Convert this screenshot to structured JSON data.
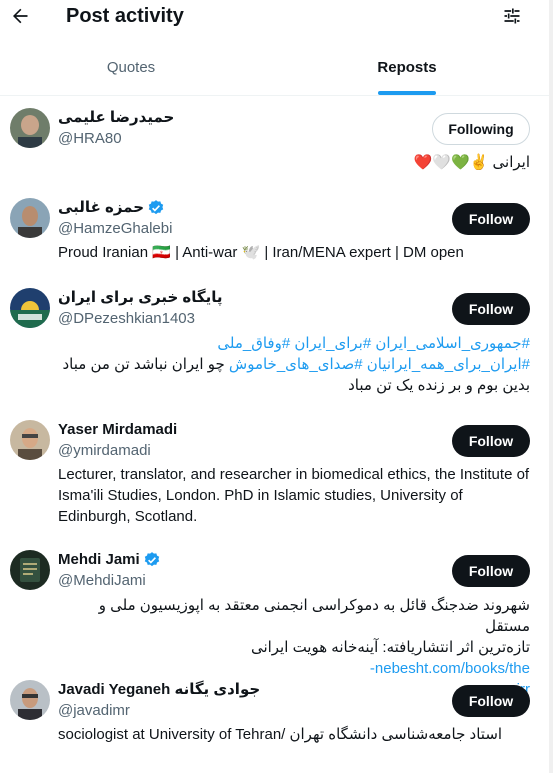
{
  "header": {
    "title": "Post activity"
  },
  "tabs": [
    {
      "label": "Quotes",
      "selected": false
    },
    {
      "label": "Reposts",
      "selected": true
    }
  ],
  "colors": {
    "accent": "#1d9bf0",
    "text_primary": "#0f1419",
    "text_secondary": "#536471",
    "follow_button_bg": "#0f1419"
  },
  "users": [
    {
      "name": "حمیدرضا علیمی",
      "handle": "@HRA80",
      "verified": false,
      "button": "Following",
      "bio": "ایرانی ✌️💚🤍❤️"
    },
    {
      "name": "حمزه غالبی",
      "handle": "@HamzeGhalebi",
      "verified": true,
      "button": "Follow",
      "bio": "Proud Iranian 🇮🇷 | Anti-war 🕊️ | Iran/MENA expert | DM open"
    },
    {
      "name": "پایگاه خبری برای ایران",
      "handle": "@DPezeshkian1403",
      "verified": false,
      "button": "Follow",
      "bio_tags_line1": "#جمهوری_اسلامی_ایران #برای_ایران #وفاق_ملی",
      "bio_tags_line2": "#ایران_برای_همه_ایرانیان #صدای_های_خاموش",
      "bio_text_line2": " چو ایران نباشد تن من مباد",
      "bio_text_line3": "بدین بوم و بر زنده یک تن مباد"
    },
    {
      "name": "Yaser Mirdamadi",
      "handle": "@ymirdamadi",
      "verified": false,
      "button": "Follow",
      "bio": "Lecturer, translator, and researcher in biomedical ethics, the Institute of Isma'ili Studies, London. PhD in Islamic studies, University of Edinburgh, Scotland."
    },
    {
      "name": "Mehdi Jami",
      "handle": "@MehdiJami",
      "verified": true,
      "button": "Follow",
      "bio_line1": "شهروند ضدجنگ قائل به دموکراسی انجمنی معتقد به اپوزیسیون ملی و مستقل",
      "bio_line2_text": "تازه‌ترین اثر انتشاریافته: آینه‌خانه هویت ایرانی",
      "bio_line2_link": "nebesht.com/books/the-",
      "bio_line3_link": "mirr..."
    },
    {
      "name": "Javadi Yeganeh جوادی یگانه",
      "handle": "@javadimr",
      "verified": false,
      "button": "Follow",
      "bio": "sociologist at University of Tehran/ استاد جامعه‌شناسی دانشگاه تهران"
    }
  ]
}
